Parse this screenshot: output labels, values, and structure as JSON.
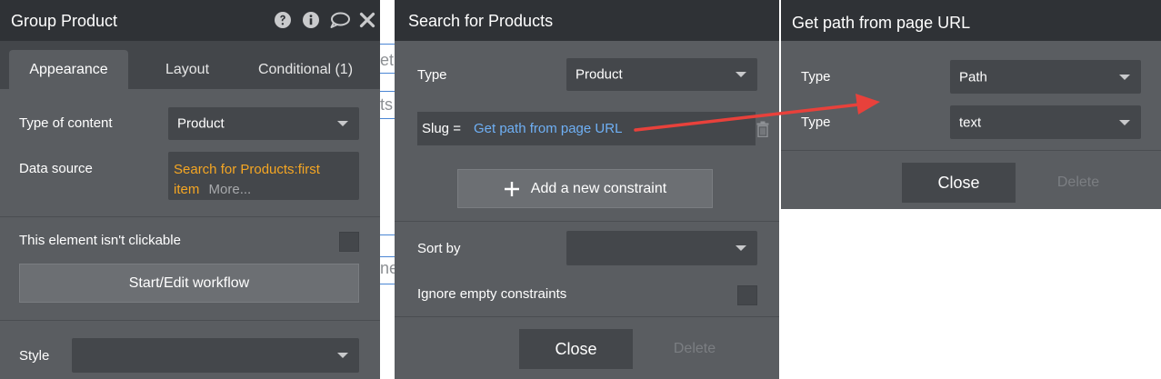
{
  "canvas": {
    "snippets": [
      "et",
      "ts",
      "ne"
    ]
  },
  "group_product": {
    "title": "Group Product",
    "tabs": [
      {
        "label": "Appearance",
        "active": true
      },
      {
        "label": "Layout",
        "active": false
      },
      {
        "label": "Conditional (1)",
        "active": false
      }
    ],
    "type_of_content": {
      "label": "Type of content",
      "value": "Product"
    },
    "data_source": {
      "label": "Data source",
      "value_line1": "Search for Products:first",
      "value_line2": "item",
      "more": "More..."
    },
    "not_clickable_label": "This element isn't clickable",
    "workflow_button": "Start/Edit workflow",
    "style_label": "Style",
    "header_icons": [
      "help-icon",
      "info-icon",
      "comment-icon",
      "close-icon"
    ]
  },
  "search_products": {
    "title": "Search for Products",
    "type": {
      "label": "Type",
      "value": "Product"
    },
    "constraint": {
      "field": "Slug =",
      "value": "Get path from page URL"
    },
    "add_constraint": "Add a new constraint",
    "sort_by_label": "Sort by",
    "ignore_empty_label": "Ignore empty constraints",
    "close": "Close",
    "delete": "Delete"
  },
  "get_path": {
    "title": "Get path from page URL",
    "rows": [
      {
        "label": "Type",
        "value": "Path"
      },
      {
        "label": "Type",
        "value": "text"
      }
    ],
    "close": "Close",
    "delete": "Delete"
  },
  "colors": {
    "panel_bg": "#5a5d61",
    "header_bg": "#2f3236",
    "link_blue": "#6fb0f5",
    "orange_value": "#f5a623",
    "arrow_red": "#e8413b"
  }
}
